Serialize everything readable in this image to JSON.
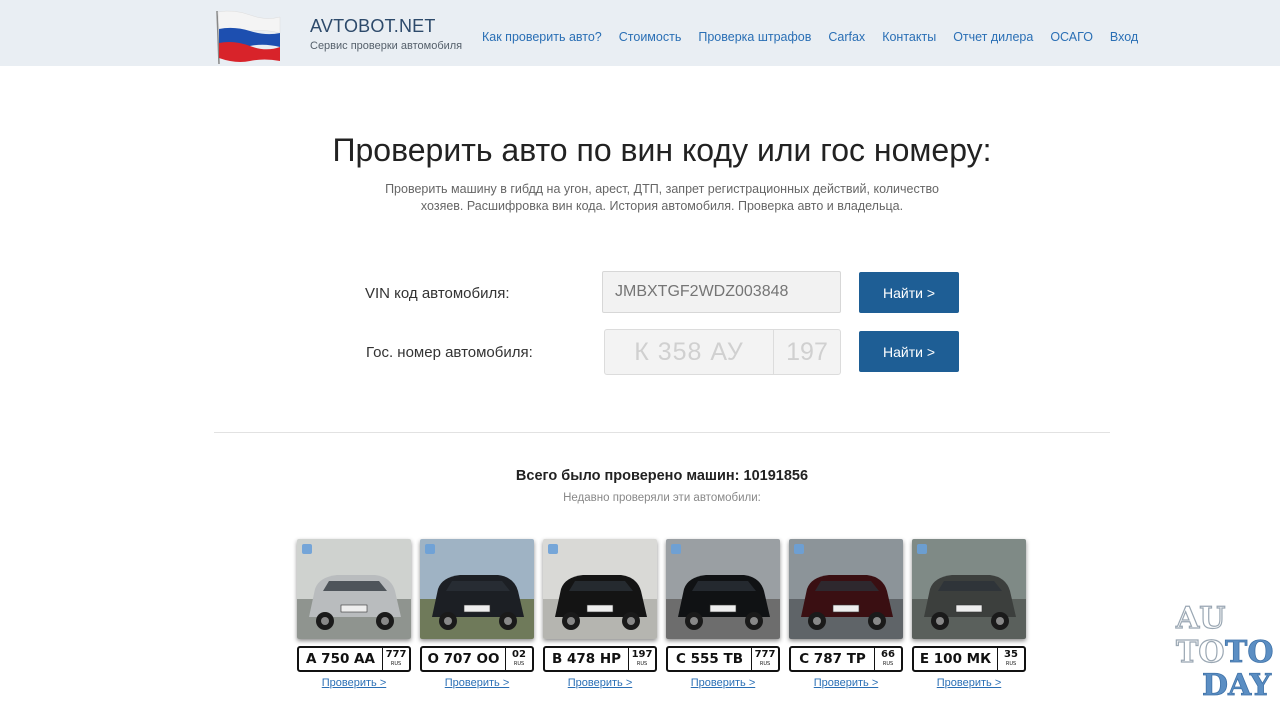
{
  "header": {
    "brand_name": "AVTOBOT.NET",
    "brand_subtitle": "Сервис проверки автомобиля",
    "nav": [
      {
        "label": "Как проверить авто?"
      },
      {
        "label": "Стоимость"
      },
      {
        "label": "Проверка штрафов"
      },
      {
        "label": "Carfax"
      },
      {
        "label": "Контакты"
      },
      {
        "label": "Отчет дилера"
      },
      {
        "label": "ОСАГО"
      },
      {
        "label": "Вход"
      }
    ]
  },
  "hero": {
    "title": "Проверить авто по вин коду или гос номеру:",
    "subtitle": "Проверить машину в гибдд на угон, арест, ДТП, запрет регистрационных действий, количество хозяев. Расшифровка вин кода. История автомобиля. Проверка авто и владельца."
  },
  "form": {
    "vin_label": "VIN код автомобиля:",
    "vin_placeholder": "JMBXTGF2WDZ003848",
    "plate_label": "Гос. номер автомобиля:",
    "plate_placeholder": "К 358 АУ",
    "region_placeholder": "197",
    "search_button": "Найти >"
  },
  "stats": {
    "total": "Всего было проверено машин: 10191856",
    "recent": "Недавно проверяли эти автомобили:"
  },
  "recent_cars": [
    {
      "plate": "А 750 АА",
      "region": "777",
      "link": "Проверить >",
      "color": "#b9bcbe"
    },
    {
      "plate": "О 707 ОО",
      "region": "02",
      "link": "Проверить >",
      "color": "#1c1f24"
    },
    {
      "plate": "В 478 НР",
      "region": "197",
      "link": "Проверить >",
      "color": "#141414"
    },
    {
      "plate": "С 555 ТВ",
      "region": "777",
      "link": "Проверить >",
      "color": "#101214"
    },
    {
      "plate": "С 787 ТР",
      "region": "66",
      "link": "Проверить >",
      "color": "#3a0f12"
    },
    {
      "plate": "Е 100 МК",
      "region": "35",
      "link": "Проверить >",
      "color": "#3c3f3d"
    }
  ],
  "plate_country": "RUS",
  "watermark": {
    "line1": "AU",
    "line2a": "TO",
    "line2b": "TO",
    "line3": "DAY"
  },
  "colors": {
    "accent": "#1e5e95",
    "link": "#2a6fb5",
    "header_bg": "#e9eef3"
  }
}
